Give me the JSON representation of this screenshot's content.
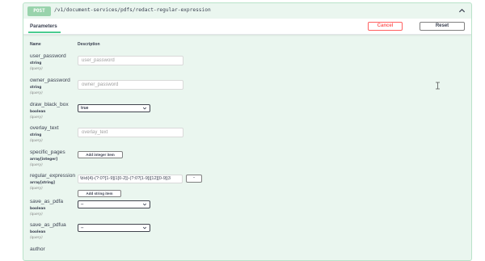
{
  "operation": {
    "method": "POST",
    "path": "/v1/document-services/pdfs/redact-regular-expression"
  },
  "tab": {
    "label": "Parameters"
  },
  "buttons": {
    "cancel": "Cancel",
    "reset": "Reset"
  },
  "columns": {
    "name": "Name",
    "description": "Description"
  },
  "params": [
    {
      "name": "user_password",
      "type": "string",
      "in": "(query)",
      "placeholder": "user_password"
    },
    {
      "name": "owner_password",
      "type": "string",
      "in": "(query)",
      "placeholder": "owner_password"
    },
    {
      "name": "draw_black_box",
      "type": "boolean",
      "in": "(query)",
      "selected": "true"
    },
    {
      "name": "overlay_text",
      "type": "string",
      "in": "(query)",
      "placeholder": "overlay_text"
    },
    {
      "name": "specific_pages",
      "type": "array[integer]",
      "in": "(query)",
      "add_label": "Add integer item"
    },
    {
      "name": "regular_expression",
      "type": "array[string]",
      "in": "(query)",
      "value": "\\b\\d{4}-(?:0?[1-9]|1[0-2])-(?:0?[1-9]|[12][0-9]|3",
      "minus_label": "-",
      "add_label": "Add string item"
    },
    {
      "name": "save_as_pdfa",
      "type": "boolean",
      "in": "(query)",
      "selected": "--"
    },
    {
      "name": "save_as_pdfua",
      "type": "boolean",
      "in": "(query)",
      "selected": "--"
    },
    {
      "name": "author"
    }
  ],
  "colors": {
    "accent": "#49cc90",
    "cancel": "#ff6060",
    "block_bg": "#eaf6ef"
  }
}
